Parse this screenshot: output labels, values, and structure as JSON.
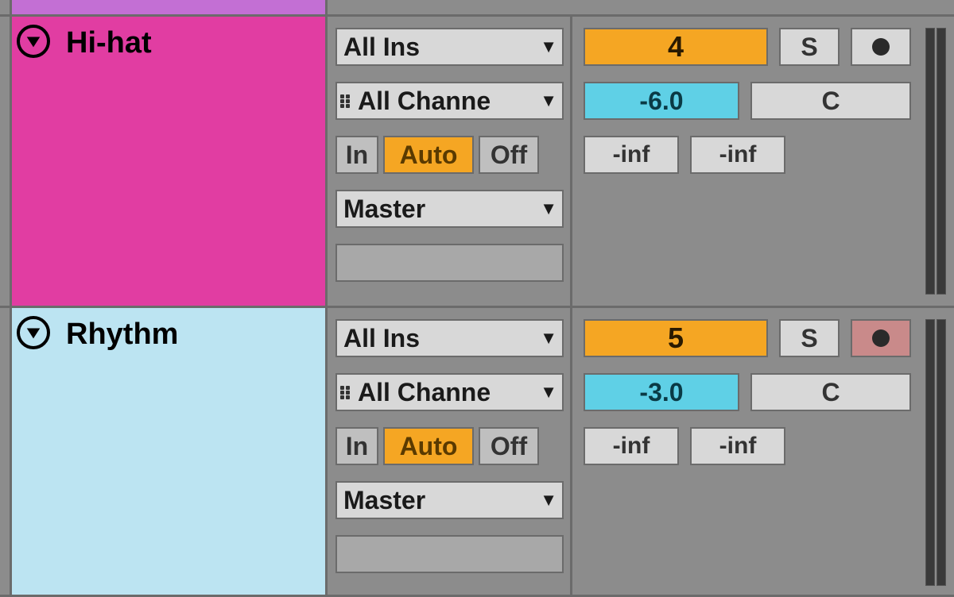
{
  "tracks": [
    {
      "name": "Hi-hat",
      "color": "pink",
      "io": {
        "input_routing": "All Ins",
        "input_channel": "All Channe",
        "monitor_in": "In",
        "monitor_auto": "Auto",
        "monitor_off": "Off",
        "output_routing": "Master"
      },
      "mixer": {
        "track_number": "4",
        "solo": "S",
        "rec_active": false,
        "volume": "-6.0",
        "pan": "C",
        "send_a": "-inf",
        "send_b": "-inf"
      }
    },
    {
      "name": "Rhythm",
      "color": "lightblue",
      "io": {
        "input_routing": "All Ins",
        "input_channel": "All Channe",
        "monitor_in": "In",
        "monitor_auto": "Auto",
        "monitor_off": "Off",
        "output_routing": "Master"
      },
      "mixer": {
        "track_number": "5",
        "solo": "S",
        "rec_active": true,
        "volume": "-3.0",
        "pan": "C",
        "send_a": "-inf",
        "send_b": "-inf"
      }
    }
  ]
}
